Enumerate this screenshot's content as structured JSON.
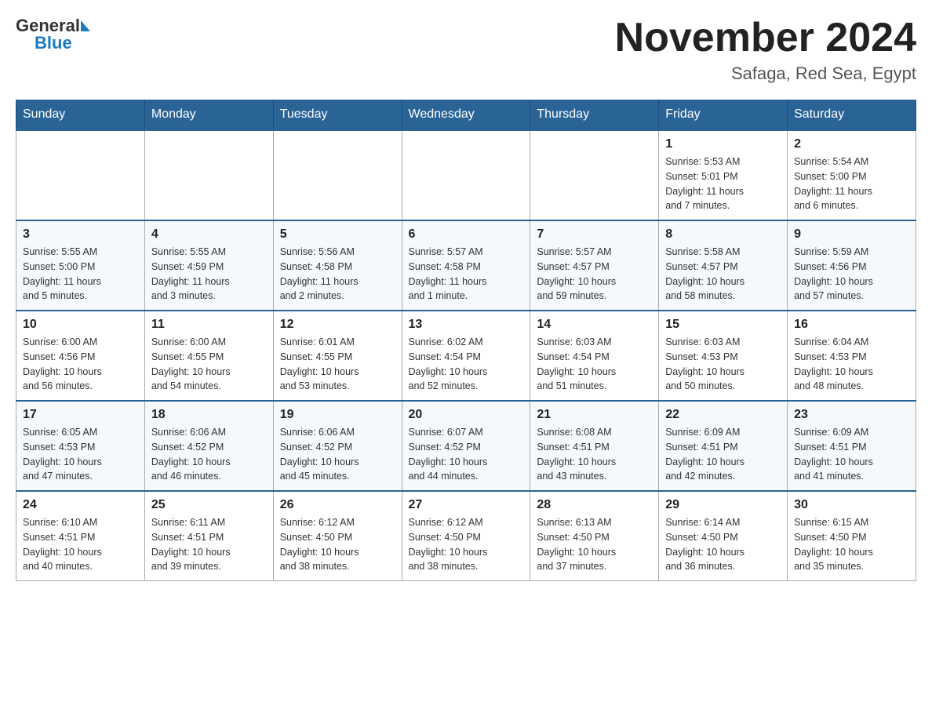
{
  "header": {
    "logo_text_general": "General",
    "logo_text_blue": "Blue",
    "title": "November 2024",
    "subtitle": "Safaga, Red Sea, Egypt"
  },
  "days_of_week": [
    "Sunday",
    "Monday",
    "Tuesday",
    "Wednesday",
    "Thursday",
    "Friday",
    "Saturday"
  ],
  "weeks": [
    [
      {
        "day": "",
        "info": ""
      },
      {
        "day": "",
        "info": ""
      },
      {
        "day": "",
        "info": ""
      },
      {
        "day": "",
        "info": ""
      },
      {
        "day": "",
        "info": ""
      },
      {
        "day": "1",
        "info": "Sunrise: 5:53 AM\nSunset: 5:01 PM\nDaylight: 11 hours\nand 7 minutes."
      },
      {
        "day": "2",
        "info": "Sunrise: 5:54 AM\nSunset: 5:00 PM\nDaylight: 11 hours\nand 6 minutes."
      }
    ],
    [
      {
        "day": "3",
        "info": "Sunrise: 5:55 AM\nSunset: 5:00 PM\nDaylight: 11 hours\nand 5 minutes."
      },
      {
        "day": "4",
        "info": "Sunrise: 5:55 AM\nSunset: 4:59 PM\nDaylight: 11 hours\nand 3 minutes."
      },
      {
        "day": "5",
        "info": "Sunrise: 5:56 AM\nSunset: 4:58 PM\nDaylight: 11 hours\nand 2 minutes."
      },
      {
        "day": "6",
        "info": "Sunrise: 5:57 AM\nSunset: 4:58 PM\nDaylight: 11 hours\nand 1 minute."
      },
      {
        "day": "7",
        "info": "Sunrise: 5:57 AM\nSunset: 4:57 PM\nDaylight: 10 hours\nand 59 minutes."
      },
      {
        "day": "8",
        "info": "Sunrise: 5:58 AM\nSunset: 4:57 PM\nDaylight: 10 hours\nand 58 minutes."
      },
      {
        "day": "9",
        "info": "Sunrise: 5:59 AM\nSunset: 4:56 PM\nDaylight: 10 hours\nand 57 minutes."
      }
    ],
    [
      {
        "day": "10",
        "info": "Sunrise: 6:00 AM\nSunset: 4:56 PM\nDaylight: 10 hours\nand 56 minutes."
      },
      {
        "day": "11",
        "info": "Sunrise: 6:00 AM\nSunset: 4:55 PM\nDaylight: 10 hours\nand 54 minutes."
      },
      {
        "day": "12",
        "info": "Sunrise: 6:01 AM\nSunset: 4:55 PM\nDaylight: 10 hours\nand 53 minutes."
      },
      {
        "day": "13",
        "info": "Sunrise: 6:02 AM\nSunset: 4:54 PM\nDaylight: 10 hours\nand 52 minutes."
      },
      {
        "day": "14",
        "info": "Sunrise: 6:03 AM\nSunset: 4:54 PM\nDaylight: 10 hours\nand 51 minutes."
      },
      {
        "day": "15",
        "info": "Sunrise: 6:03 AM\nSunset: 4:53 PM\nDaylight: 10 hours\nand 50 minutes."
      },
      {
        "day": "16",
        "info": "Sunrise: 6:04 AM\nSunset: 4:53 PM\nDaylight: 10 hours\nand 48 minutes."
      }
    ],
    [
      {
        "day": "17",
        "info": "Sunrise: 6:05 AM\nSunset: 4:53 PM\nDaylight: 10 hours\nand 47 minutes."
      },
      {
        "day": "18",
        "info": "Sunrise: 6:06 AM\nSunset: 4:52 PM\nDaylight: 10 hours\nand 46 minutes."
      },
      {
        "day": "19",
        "info": "Sunrise: 6:06 AM\nSunset: 4:52 PM\nDaylight: 10 hours\nand 45 minutes."
      },
      {
        "day": "20",
        "info": "Sunrise: 6:07 AM\nSunset: 4:52 PM\nDaylight: 10 hours\nand 44 minutes."
      },
      {
        "day": "21",
        "info": "Sunrise: 6:08 AM\nSunset: 4:51 PM\nDaylight: 10 hours\nand 43 minutes."
      },
      {
        "day": "22",
        "info": "Sunrise: 6:09 AM\nSunset: 4:51 PM\nDaylight: 10 hours\nand 42 minutes."
      },
      {
        "day": "23",
        "info": "Sunrise: 6:09 AM\nSunset: 4:51 PM\nDaylight: 10 hours\nand 41 minutes."
      }
    ],
    [
      {
        "day": "24",
        "info": "Sunrise: 6:10 AM\nSunset: 4:51 PM\nDaylight: 10 hours\nand 40 minutes."
      },
      {
        "day": "25",
        "info": "Sunrise: 6:11 AM\nSunset: 4:51 PM\nDaylight: 10 hours\nand 39 minutes."
      },
      {
        "day": "26",
        "info": "Sunrise: 6:12 AM\nSunset: 4:50 PM\nDaylight: 10 hours\nand 38 minutes."
      },
      {
        "day": "27",
        "info": "Sunrise: 6:12 AM\nSunset: 4:50 PM\nDaylight: 10 hours\nand 38 minutes."
      },
      {
        "day": "28",
        "info": "Sunrise: 6:13 AM\nSunset: 4:50 PM\nDaylight: 10 hours\nand 37 minutes."
      },
      {
        "day": "29",
        "info": "Sunrise: 6:14 AM\nSunset: 4:50 PM\nDaylight: 10 hours\nand 36 minutes."
      },
      {
        "day": "30",
        "info": "Sunrise: 6:15 AM\nSunset: 4:50 PM\nDaylight: 10 hours\nand 35 minutes."
      }
    ]
  ]
}
